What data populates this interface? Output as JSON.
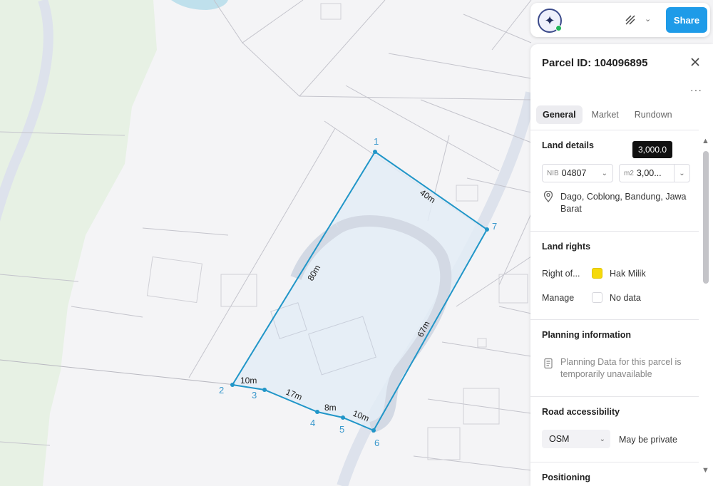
{
  "toolbar": {
    "share_label": "Share",
    "ai_icon": "sparkle-icon",
    "draw_icon": "pen-tool-icon"
  },
  "panel": {
    "title": "Parcel ID: 104096895",
    "tabs": [
      {
        "label": "General",
        "active": true
      },
      {
        "label": "Market",
        "active": false
      },
      {
        "label": "Rundown",
        "active": false
      }
    ],
    "land_details": {
      "title": "Land details",
      "nib_prefix": "NIB",
      "nib_value": "04807",
      "area_prefix": "m2",
      "area_value": "3,00...",
      "area_tooltip": "3,000.0",
      "address": "Dago, Coblong, Bandung, Jawa Barat"
    },
    "land_rights": {
      "title": "Land rights",
      "rows": [
        {
          "label": "Right of...",
          "value": "Hak Milik",
          "color": "#f5d90a"
        },
        {
          "label": "Manage",
          "value": "No data",
          "color": "#ffffff"
        }
      ]
    },
    "planning": {
      "title": "Planning information",
      "message": "Planning Data for this parcel is temporarily unavailable"
    },
    "road": {
      "title": "Road accessibility",
      "source": "OSM",
      "status": "May be private"
    },
    "positioning": {
      "title": "Positioning"
    }
  },
  "map": {
    "parcel_color": "#2196c8",
    "vertices": [
      {
        "label": "1"
      },
      {
        "label": "2"
      },
      {
        "label": "3"
      },
      {
        "label": "4"
      },
      {
        "label": "5"
      },
      {
        "label": "6"
      },
      {
        "label": "7"
      }
    ],
    "edges": [
      {
        "label": "40m"
      },
      {
        "label": "80m"
      },
      {
        "label": "10m"
      },
      {
        "label": "17m"
      },
      {
        "label": "8m"
      },
      {
        "label": "10m"
      },
      {
        "label": "67m"
      }
    ]
  }
}
